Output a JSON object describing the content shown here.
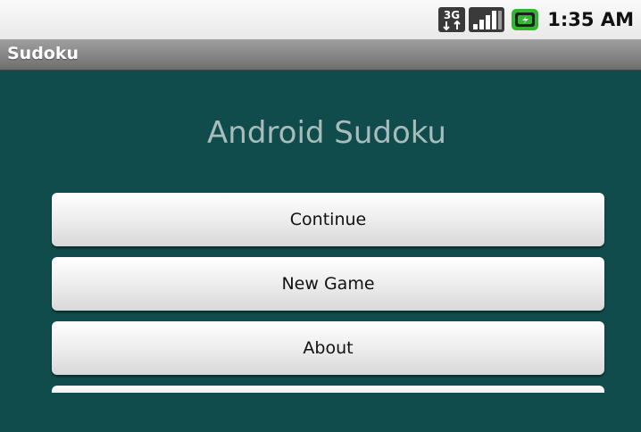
{
  "status_bar": {
    "time": "1:35 AM",
    "icons": [
      "3g-data-icon",
      "signal-strength-icon",
      "battery-charging-icon"
    ],
    "network_label": "3G"
  },
  "title_bar": {
    "title": "Sudoku"
  },
  "main": {
    "heading": "Android Sudoku",
    "buttons": [
      {
        "label": "Continue"
      },
      {
        "label": "New Game"
      },
      {
        "label": "About"
      }
    ]
  },
  "colors": {
    "background": "#104c4c",
    "heading_text": "#a9bcbc",
    "title_bar": "#8a8a8a",
    "button_face": "#f1f1f1",
    "battery_accent": "#2fb82f"
  }
}
